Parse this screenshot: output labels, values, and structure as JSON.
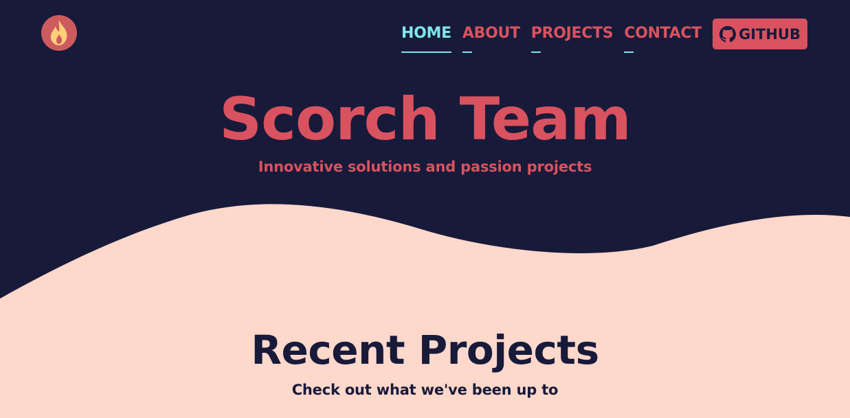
{
  "colors": {
    "navy": "#181a3a",
    "peach": "#ffd8cc",
    "coral": "#d9525f",
    "cyan": "#7de6ea",
    "logo_bg": "#cd5b5e",
    "flame": "#ffcf7a"
  },
  "header": {
    "logo_icon": "flame-icon",
    "nav": [
      {
        "label": "HOME",
        "active": true
      },
      {
        "label": "ABOUT",
        "active": false
      },
      {
        "label": "PROJECTS",
        "active": false
      },
      {
        "label": "CONTACT",
        "active": false
      }
    ],
    "github": {
      "icon": "github-icon",
      "label": "GITHUB"
    }
  },
  "hero": {
    "title": "Scorch Team",
    "subtitle": "Innovative solutions and passion projects"
  },
  "projects": {
    "title": "Recent Projects",
    "subtitle": "Check out what we've been up to"
  }
}
